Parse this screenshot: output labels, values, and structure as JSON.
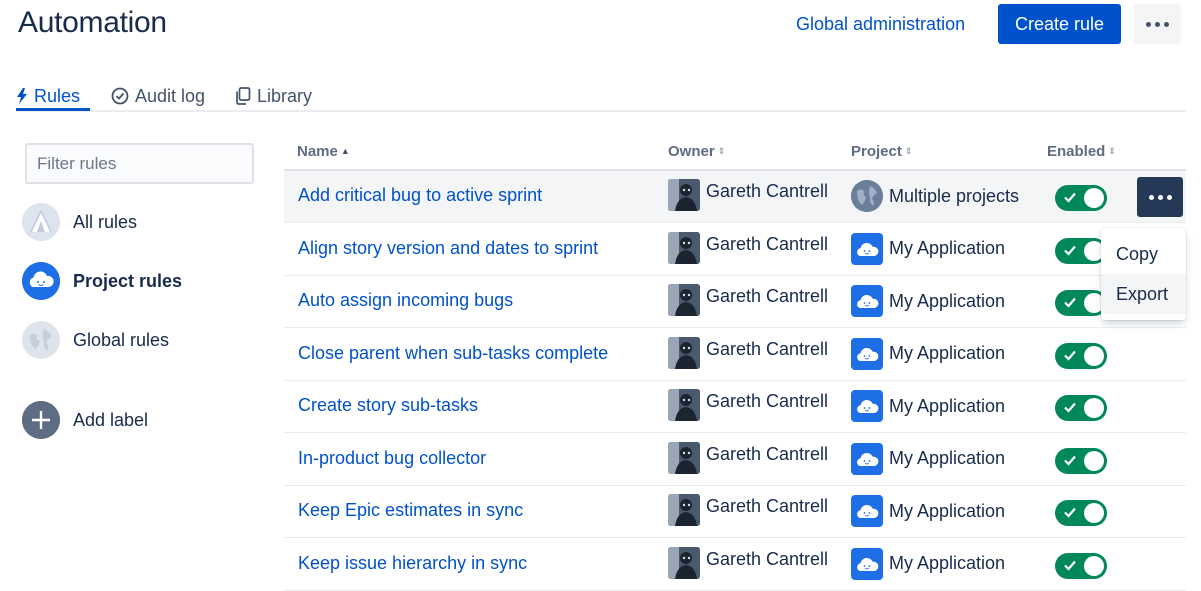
{
  "header": {
    "title": "Automation",
    "global_admin_label": "Global administration",
    "create_rule_label": "Create rule"
  },
  "tabs": [
    {
      "label": "Rules",
      "icon": "lightning-icon",
      "active": true
    },
    {
      "label": "Audit log",
      "icon": "check-circle-icon",
      "active": false
    },
    {
      "label": "Library",
      "icon": "copy-pages-icon",
      "active": false
    }
  ],
  "sidebar": {
    "filter_placeholder": "Filter rules",
    "items": [
      {
        "label": "All rules",
        "icon": "tent-icon"
      },
      {
        "label": "Project rules",
        "icon": "cloud-icon",
        "selected": true
      },
      {
        "label": "Global rules",
        "icon": "globe-icon"
      },
      {
        "label": "Add label",
        "icon": "plus-icon"
      }
    ]
  },
  "table": {
    "columns": [
      "Name",
      "Owner",
      "Project",
      "Enabled"
    ],
    "sorted_column": "Name",
    "rows": [
      {
        "name": "Add critical bug to active sprint",
        "owner": "Gareth Cantrell",
        "project": "Multiple projects",
        "project_icon": "globe-icon",
        "enabled": true
      },
      {
        "name": "Align story version and dates to sprint",
        "owner": "Gareth Cantrell",
        "project": "My Application",
        "project_icon": "cloud-icon",
        "enabled": true
      },
      {
        "name": "Auto assign incoming bugs",
        "owner": "Gareth Cantrell",
        "project": "My Application",
        "project_icon": "cloud-icon",
        "enabled": true
      },
      {
        "name": "Close parent when sub-tasks complete",
        "owner": "Gareth Cantrell",
        "project": "My Application",
        "project_icon": "cloud-icon",
        "enabled": true
      },
      {
        "name": "Create story sub-tasks",
        "owner": "Gareth Cantrell",
        "project": "My Application",
        "project_icon": "cloud-icon",
        "enabled": true
      },
      {
        "name": "In-product bug collector",
        "owner": "Gareth Cantrell",
        "project": "My Application",
        "project_icon": "cloud-icon",
        "enabled": true
      },
      {
        "name": "Keep Epic estimates in sync",
        "owner": "Gareth Cantrell",
        "project": "My Application",
        "project_icon": "cloud-icon",
        "enabled": true
      },
      {
        "name": "Keep issue hierarchy in sync",
        "owner": "Gareth Cantrell",
        "project": "My Application",
        "project_icon": "cloud-icon",
        "enabled": true
      }
    ]
  },
  "row_menu": {
    "items": [
      "Copy",
      "Export"
    ]
  },
  "colors": {
    "link": "#0052cc",
    "primary_button": "#0052cc",
    "toggle_on": "#00875a",
    "text": "#172b4d"
  }
}
